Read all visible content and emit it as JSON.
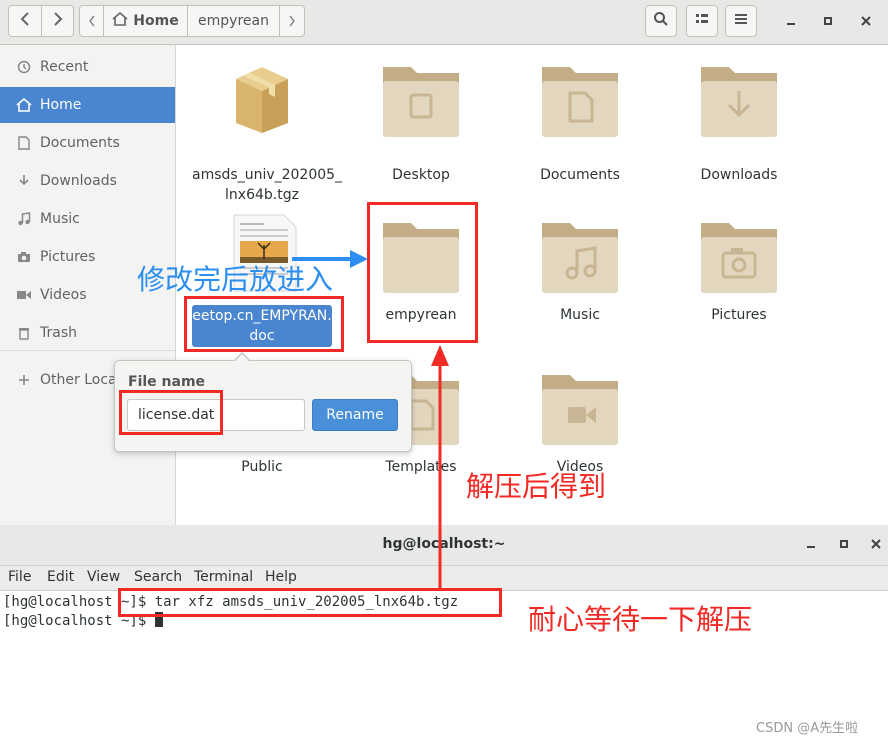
{
  "header": {
    "back_icon": "chevron-left-icon",
    "forward_icon": "chevron-right-icon",
    "breadcrumbs": [
      {
        "label": "Home",
        "icon": "home-icon"
      },
      {
        "label": "empyrean"
      }
    ]
  },
  "sidebar": {
    "items": [
      {
        "label": "Recent",
        "icon": "clock-icon"
      },
      {
        "label": "Home",
        "icon": "home-icon",
        "active": true
      },
      {
        "label": "Documents",
        "icon": "document-icon"
      },
      {
        "label": "Downloads",
        "icon": "download-icon"
      },
      {
        "label": "Music",
        "icon": "music-icon"
      },
      {
        "label": "Pictures",
        "icon": "camera-icon"
      },
      {
        "label": "Videos",
        "icon": "video-icon"
      },
      {
        "label": "Trash",
        "icon": "trash-icon"
      },
      {
        "label": "Other Locat",
        "icon": "plus-icon"
      }
    ]
  },
  "files": [
    {
      "name": "amsds_univ_202005_\nlnx64b.tgz",
      "type": "archive"
    },
    {
      "name": "Desktop",
      "type": "folder",
      "emblem": "desktop"
    },
    {
      "name": "Documents",
      "type": "folder",
      "emblem": "document"
    },
    {
      "name": "Downloads",
      "type": "folder",
      "emblem": "download"
    },
    {
      "name": "eetop.cn_EMPYRAN.\ndoc",
      "type": "document",
      "selected": true
    },
    {
      "name": "empyrean",
      "type": "folder"
    },
    {
      "name": "Music",
      "type": "folder",
      "emblem": "music"
    },
    {
      "name": "Pictures",
      "type": "folder",
      "emblem": "camera"
    },
    {
      "name": "Public",
      "type": "folder"
    },
    {
      "name": "Templates",
      "type": "folder",
      "emblem": "document"
    },
    {
      "name": "Videos",
      "type": "folder",
      "emblem": "video"
    }
  ],
  "rename_popover": {
    "title": "File name",
    "value": "license.dat",
    "button": "Rename"
  },
  "annotations": {
    "rename_note": "修改完后放进入",
    "extract_note": "解压后得到",
    "wait_note": "耐心等待一下解压"
  },
  "terminal": {
    "title": "hg@localhost:~",
    "menu": [
      "File",
      "Edit",
      "View",
      "Search",
      "Terminal",
      "Help"
    ],
    "lines": [
      "[hg@localhost ~]$ tar xfz amsds_univ_202005_lnx64b.tgz",
      "[hg@localhost ~]$ "
    ]
  },
  "watermark": "CSDN @A先生啦",
  "colors": {
    "accent": "#4a86cf",
    "folder": "#d4c3a4",
    "annotation_red": "#f12a25",
    "annotation_blue": "#2b8ef0"
  }
}
